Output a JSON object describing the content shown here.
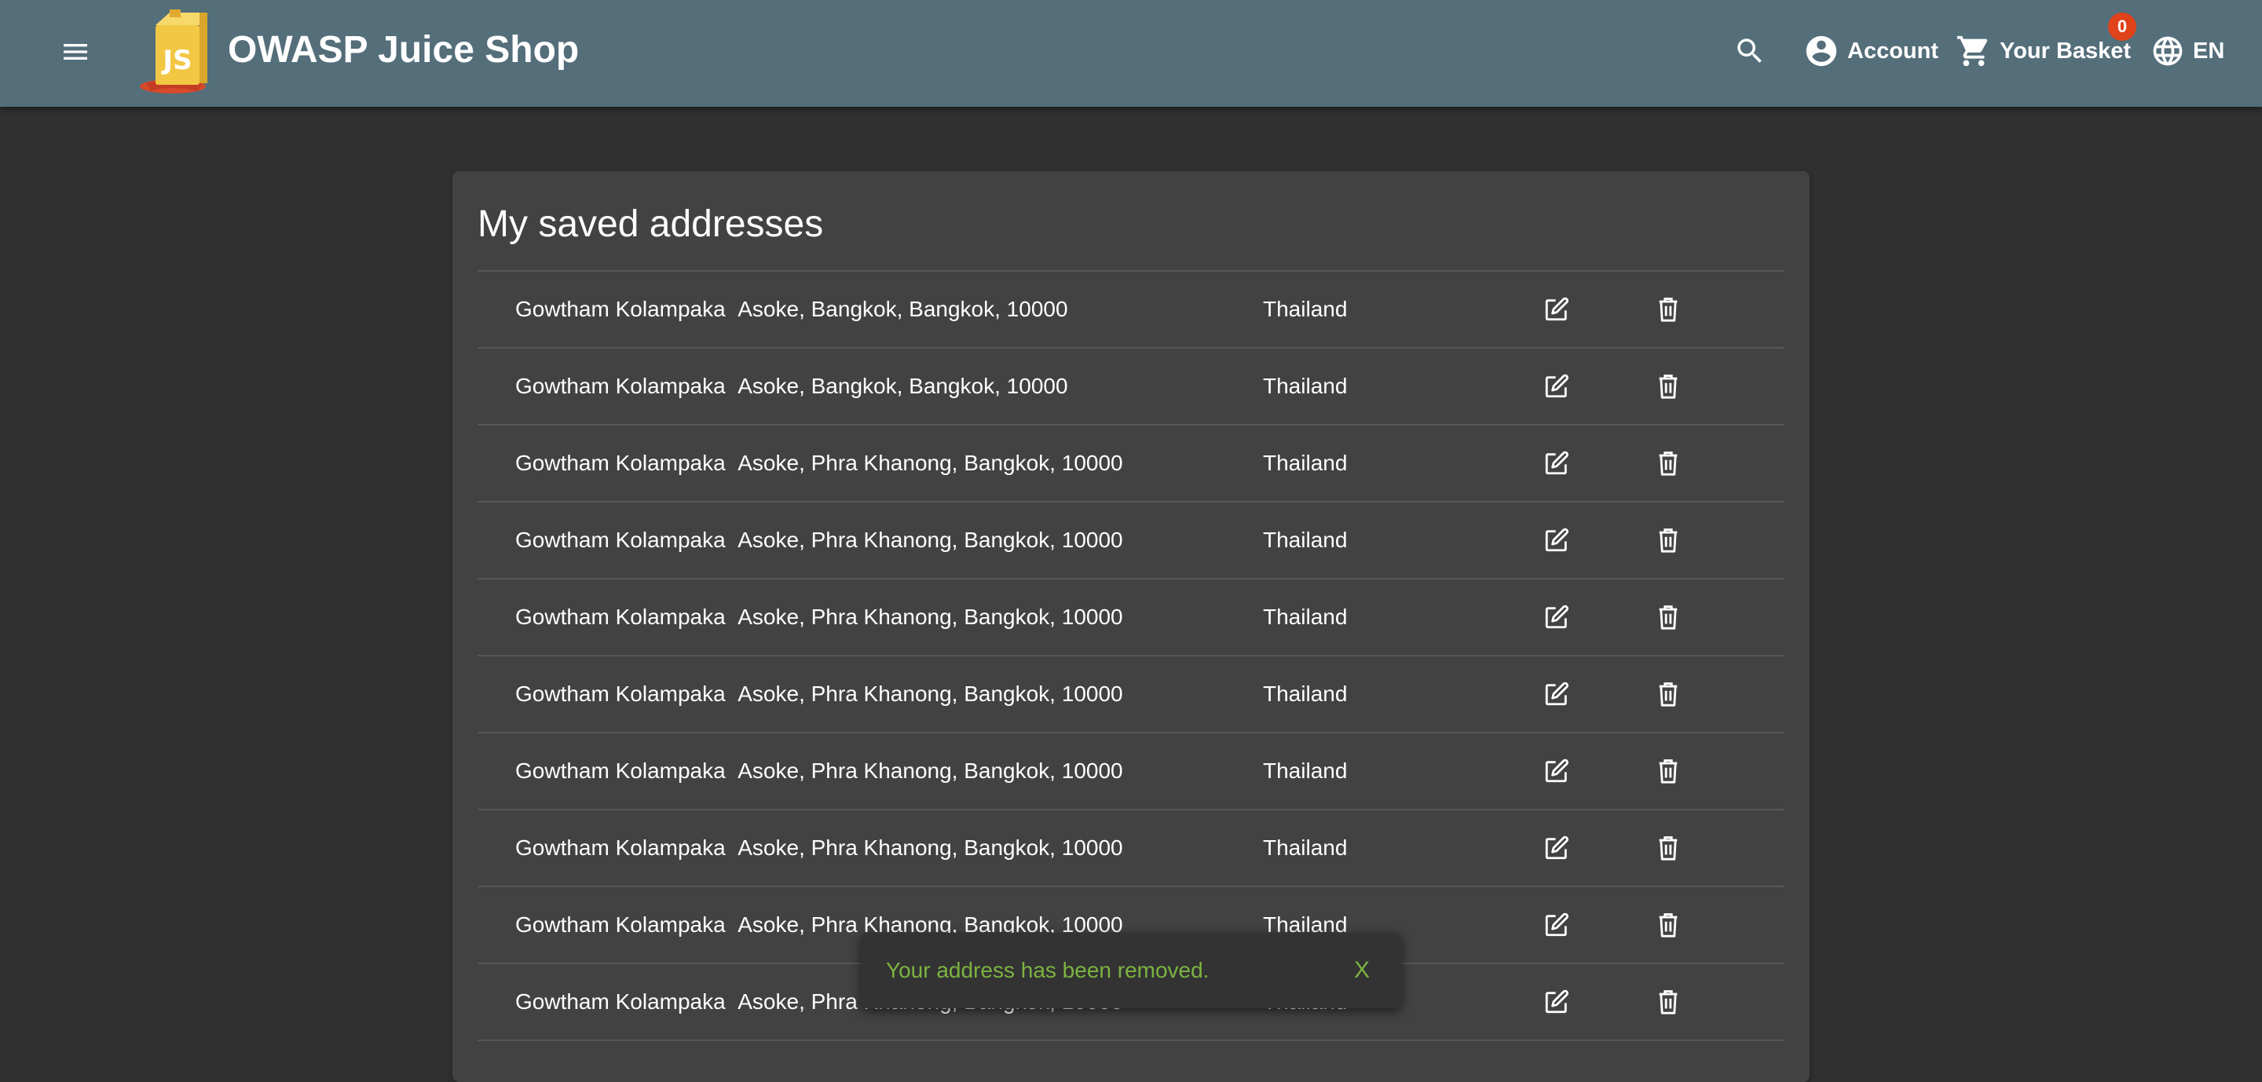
{
  "toolbar": {
    "app_title": "OWASP Juice Shop",
    "menu_icon": "menu-icon",
    "search_icon": "search-icon",
    "account_label": "Account",
    "basket_label": "Your Basket",
    "basket_count": "0",
    "language_label": "EN",
    "background_color": "#546e7a"
  },
  "page": {
    "title": "My saved addresses"
  },
  "addresses": [
    {
      "name": "Gowtham Kolampaka",
      "address": "Asoke, Bangkok, Bangkok, 10000",
      "country": "Thailand"
    },
    {
      "name": "Gowtham Kolampaka",
      "address": "Asoke, Bangkok, Bangkok, 10000",
      "country": "Thailand"
    },
    {
      "name": "Gowtham Kolampaka",
      "address": "Asoke, Phra Khanong, Bangkok, 10000",
      "country": "Thailand"
    },
    {
      "name": "Gowtham Kolampaka",
      "address": "Asoke, Phra Khanong, Bangkok, 10000",
      "country": "Thailand"
    },
    {
      "name": "Gowtham Kolampaka",
      "address": "Asoke, Phra Khanong, Bangkok, 10000",
      "country": "Thailand"
    },
    {
      "name": "Gowtham Kolampaka",
      "address": "Asoke, Phra Khanong, Bangkok, 10000",
      "country": "Thailand"
    },
    {
      "name": "Gowtham Kolampaka",
      "address": "Asoke, Phra Khanong, Bangkok, 10000",
      "country": "Thailand"
    },
    {
      "name": "Gowtham Kolampaka",
      "address": "Asoke, Phra Khanong, Bangkok, 10000",
      "country": "Thailand"
    },
    {
      "name": "Gowtham Kolampaka",
      "address": "Asoke, Phra Khanong, Bangkok, 10000",
      "country": "Thailand"
    },
    {
      "name": "Gowtham Kolampaka",
      "address": "Asoke, Phra Khanong, Bangkok, 10000",
      "country": "Thailand"
    }
  ],
  "row_icons": {
    "edit": "edit-icon",
    "delete": "trash-icon"
  },
  "snackbar": {
    "message": "Your address has been removed.",
    "close_label": "X",
    "text_color": "#7cb342"
  }
}
